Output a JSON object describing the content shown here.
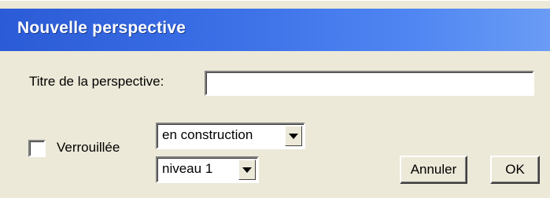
{
  "dialog": {
    "title": "Nouvelle perspective",
    "title_label": "Titre de la perspective:",
    "title_value": "",
    "locked_label": "Verrouillée",
    "locked_checked": false,
    "status_select": {
      "selected": "en construction"
    },
    "level_select": {
      "selected": "niveau 1"
    },
    "cancel_label": "Annuler",
    "ok_label": "OK"
  },
  "colors": {
    "titlebar_start": "#2b5bd6",
    "titlebar_end": "#6a9cf5",
    "dialog_bg": "#ece9d8"
  }
}
